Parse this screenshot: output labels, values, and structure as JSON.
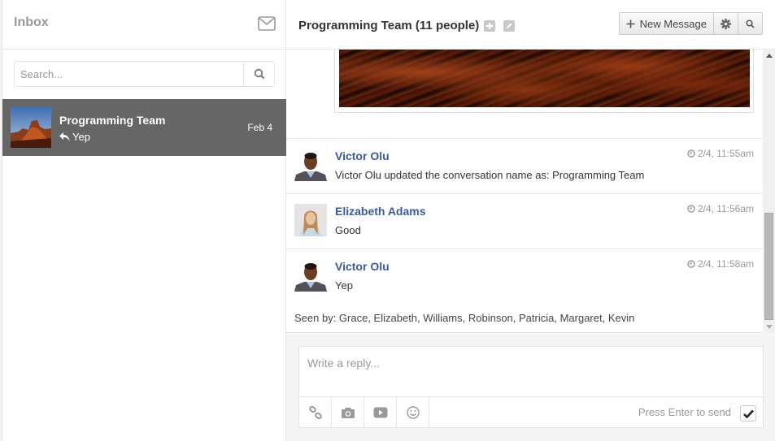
{
  "sidebar": {
    "title": "Inbox",
    "compose_icon": "envelope-icon",
    "search": {
      "placeholder": "Search...",
      "value": "",
      "button_icon": "search-icon"
    },
    "conversations": [
      {
        "name": "Programming Team",
        "last_message": "Yep",
        "last_message_icon": "reply-icon",
        "date": "Feb 4",
        "selected": true,
        "thumbnail": "desert-butte-photo"
      }
    ]
  },
  "header": {
    "title": "Programming Team (11 people)",
    "add_people_icon": "plus-square-icon",
    "edit_icon": "pencil-icon",
    "new_message_label": "New Message",
    "new_message_icon": "plus-icon",
    "settings_icon": "gear-icon",
    "search_icon": "search-icon"
  },
  "messages": [
    {
      "author": "Victor Olu",
      "text": "Victor Olu updated the conversation name as: Programming Team",
      "time": "2/4, 11:55am"
    },
    {
      "author": "Elizabeth Adams",
      "text": "Good",
      "time": "2/4, 11:56am"
    },
    {
      "author": "Victor Olu",
      "text": "Yep",
      "time": "2/4, 11:58am"
    }
  ],
  "seen_by": "Seen by: Grace, Elizabeth, Williams, Robinson, Patricia, Margaret, Kevin",
  "reply": {
    "placeholder": "Write a reply...",
    "value": "",
    "tools": [
      "link-icon",
      "camera-icon",
      "video-icon",
      "smiley-icon"
    ],
    "enter_to_send_label": "Press Enter to send",
    "enter_to_send_checked": true
  },
  "colors": {
    "selected_conversation_bg": "#666666",
    "author_link": "#3b5998"
  }
}
